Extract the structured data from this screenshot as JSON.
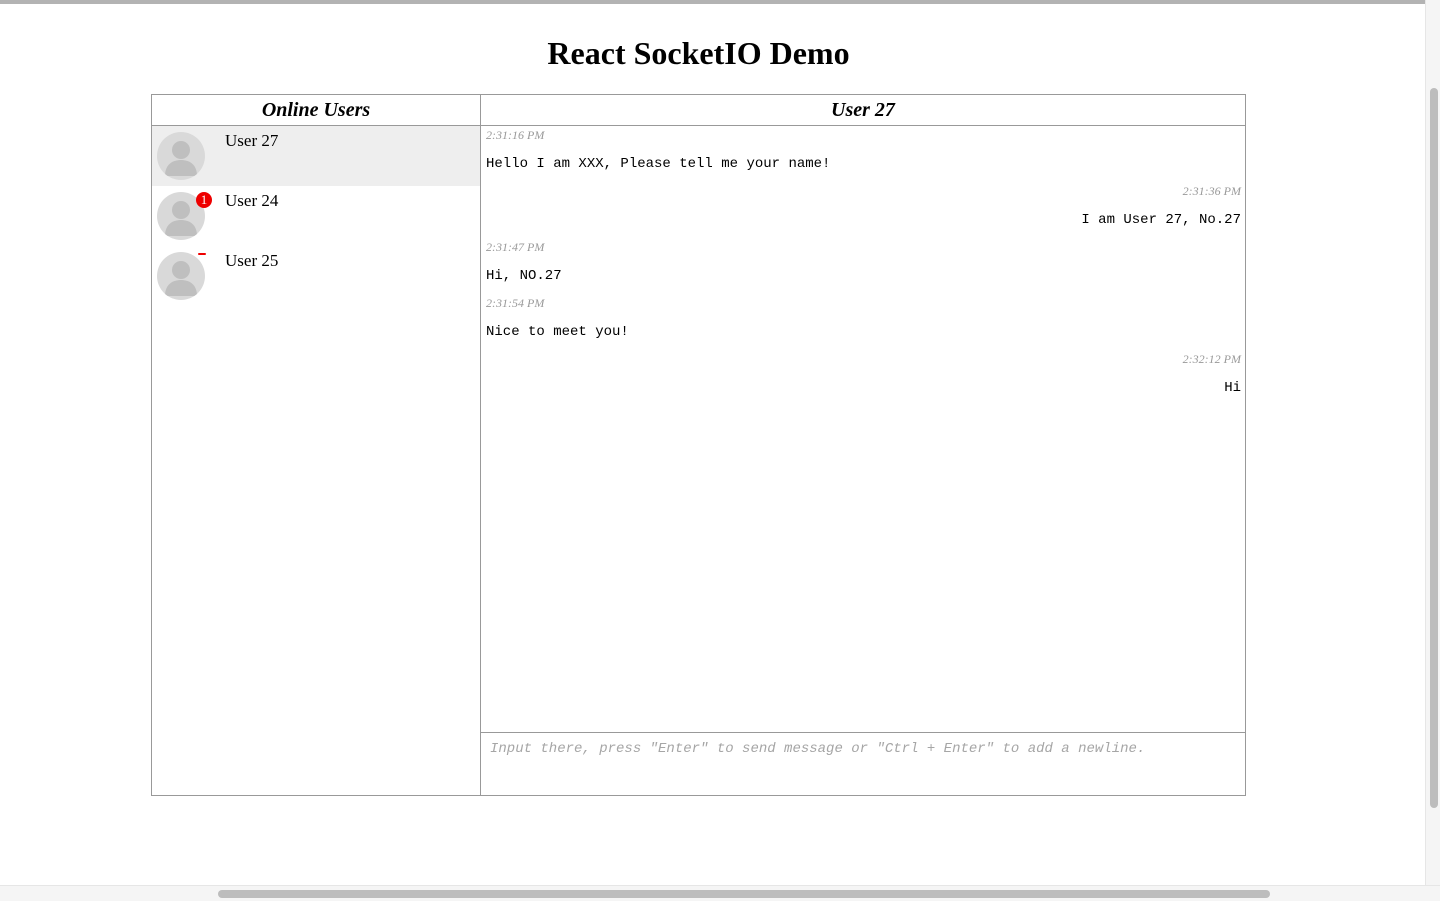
{
  "page": {
    "title": "React SocketIO Demo"
  },
  "users_panel": {
    "header": "Online Users",
    "users": [
      {
        "name": "User 27",
        "badge": "",
        "active": true
      },
      {
        "name": "User 24",
        "badge": "1",
        "active": false
      },
      {
        "name": "User 25",
        "badge": "",
        "active": false
      }
    ]
  },
  "chat": {
    "header": "User 27",
    "messages": [
      {
        "time": "2:31:16 PM",
        "text": "Hello I am XXX, Please tell me your name!",
        "side": "left"
      },
      {
        "time": "2:31:36 PM",
        "text": "I am User 27, No.27",
        "side": "right"
      },
      {
        "time": "2:31:47 PM",
        "text": "Hi, NO.27",
        "side": "left"
      },
      {
        "time": "2:31:54 PM",
        "text": "Nice to meet you!",
        "side": "left"
      },
      {
        "time": "2:32:12 PM",
        "text": "Hi",
        "side": "right"
      }
    ],
    "input": {
      "value": "",
      "placeholder": "Input there, press \"Enter\" to send message or \"Ctrl + Enter\" to add a newline."
    }
  },
  "colors": {
    "border": "#999999",
    "active_user_bg": "#eeeeee",
    "badge": "#ee0000",
    "timestamp": "#999999"
  },
  "icons": {
    "avatar": "user-avatar-icon"
  }
}
